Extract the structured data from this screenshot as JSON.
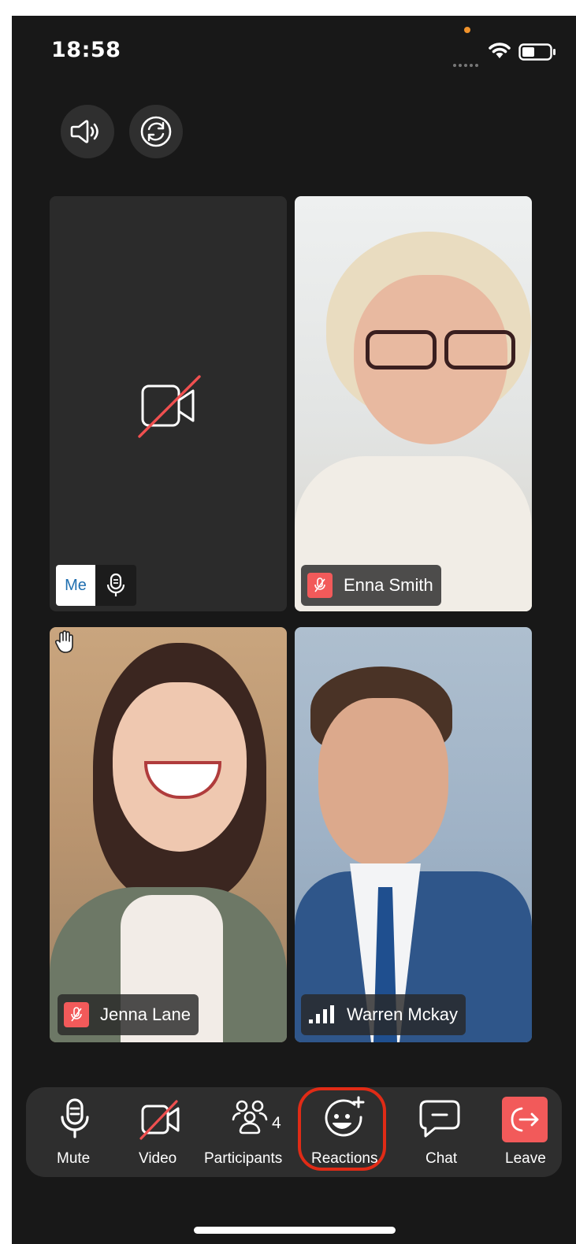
{
  "status_bar": {
    "time": "18:58"
  },
  "tiles": {
    "me": {
      "label": "Me"
    },
    "enna": {
      "name": "Enna Smith"
    },
    "jenna": {
      "name": "Jenna Lane"
    },
    "warren": {
      "name": "Warren Mckay"
    }
  },
  "toolbar": {
    "mute_label": "Mute",
    "video_label": "Video",
    "participants_label": "Participants",
    "participants_count": "4",
    "reactions_label": "Reactions",
    "chat_label": "Chat",
    "leave_label": "Leave"
  },
  "colors": {
    "background": "#181818",
    "toolbar": "#2e2e2e",
    "leave_red": "#f25a5a",
    "highlight_red": "#e02b16",
    "me_blue": "#1f6fb0"
  },
  "icons": [
    "speaker-icon",
    "camera-switch-icon",
    "video-off-icon",
    "microphone-icon",
    "mic-off-icon",
    "raised-hand-icon",
    "signal-bars-icon",
    "participants-icon",
    "reactions-icon",
    "chat-icon",
    "leave-icon",
    "wifi-icon",
    "battery-icon"
  ]
}
